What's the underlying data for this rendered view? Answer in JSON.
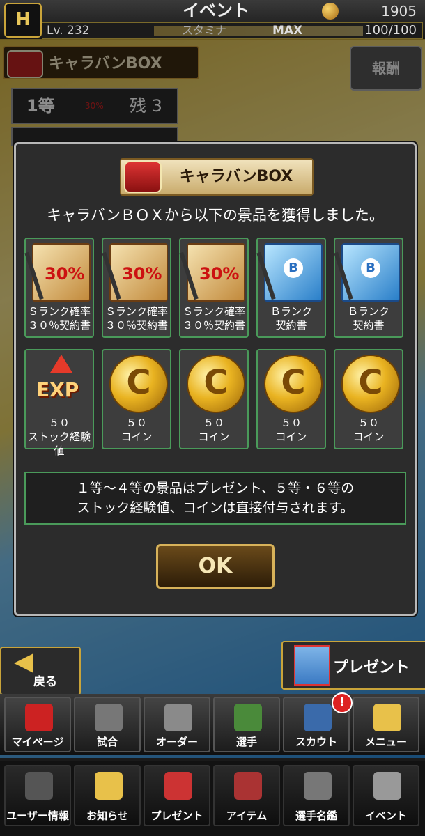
{
  "status": {
    "logo_text": "H",
    "title": "イベント",
    "coins": "1905",
    "level": "Lv. 232",
    "stamina_label": "スタミナ",
    "stamina_max_label": "MAX",
    "stamina_value": "100/100"
  },
  "background": {
    "box_title": "キャラバンBOX",
    "reward_button": "報酬",
    "rank1_label": "1等",
    "rank1_remaining": "残 3",
    "rank1_card_percent": "30%"
  },
  "dialog": {
    "title": "キャラバンBOX",
    "message": "キャラバンＢＯＸから以下の景品を獲得しました。",
    "items": [
      {
        "type": "card-s",
        "art": "30%",
        "label": "Ｓランク確率\n３０％契約書"
      },
      {
        "type": "card-s",
        "art": "30%",
        "label": "Ｓランク確率\n３０％契約書"
      },
      {
        "type": "card-s",
        "art": "30%",
        "label": "Ｓランク確率\n３０％契約書"
      },
      {
        "type": "card-b",
        "art": "B",
        "label": "Ｂランク\n契約書"
      },
      {
        "type": "card-b",
        "art": "B",
        "label": "Ｂランク\n契約書"
      },
      {
        "type": "exp",
        "art": "EXP",
        "label": "５０\nストック経験値"
      },
      {
        "type": "coin",
        "art": "C",
        "label": "５０\nコイン"
      },
      {
        "type": "coin",
        "art": "C",
        "label": "５０\nコイン"
      },
      {
        "type": "coin",
        "art": "C",
        "label": "５０\nコイン"
      },
      {
        "type": "coin",
        "art": "C",
        "label": "５０\nコイン"
      }
    ],
    "note": "１等～４等の景品はプレゼント、５等・６等の\nストック経験値、コインは直接付与されます。",
    "ok_label": "OK"
  },
  "controls": {
    "back_label": "戻る",
    "present_label": "プレゼント"
  },
  "nav_main": [
    {
      "name": "mypage",
      "label": "マイページ",
      "icon": "letter-a-icon",
      "color": "#c22"
    },
    {
      "name": "match",
      "label": "試合",
      "icon": "baseball-field-icon",
      "color": "#777"
    },
    {
      "name": "order",
      "label": "オーダー",
      "icon": "diamond-field-icon",
      "color": "#8a8a8a"
    },
    {
      "name": "players",
      "label": "選手",
      "icon": "pitcher-icon",
      "color": "#4a8a3a"
    },
    {
      "name": "scout",
      "label": "スカウト",
      "icon": "scout-card-icon",
      "color": "#3a6aaa",
      "badge": "!"
    },
    {
      "name": "menu",
      "label": "メニュー",
      "icon": "menu-character-icon",
      "color": "#e8c14a"
    }
  ],
  "nav_sub": [
    {
      "name": "user-info",
      "label": "ユーザー情報",
      "icon": "user-info-icon",
      "color": "#555"
    },
    {
      "name": "news",
      "label": "お知らせ",
      "icon": "news-icon",
      "color": "#e8c14a"
    },
    {
      "name": "present",
      "label": "プレゼント",
      "icon": "gift-icon",
      "color": "#c33"
    },
    {
      "name": "items",
      "label": "アイテム",
      "icon": "item-book-icon",
      "color": "#a33"
    },
    {
      "name": "player-book",
      "label": "選手名鑑",
      "icon": "player-book-icon",
      "color": "#777"
    },
    {
      "name": "event",
      "label": "イベント",
      "icon": "baseball-bats-icon",
      "color": "#999"
    }
  ]
}
